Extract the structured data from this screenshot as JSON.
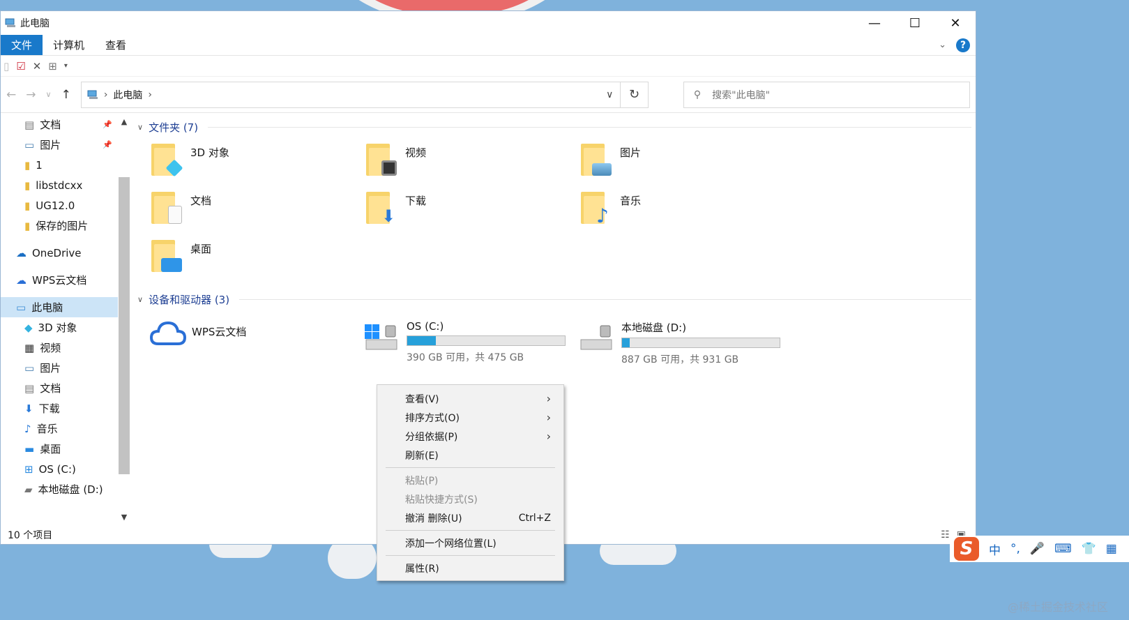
{
  "window": {
    "title": "此电脑",
    "minimize": "—",
    "maximize": "☐",
    "close": "✕"
  },
  "ribbon": {
    "tabs": [
      "文件",
      "计算机",
      "查看"
    ],
    "help": "?"
  },
  "navigation": {
    "address_location": "此电脑",
    "search_placeholder": "搜索\"此电脑\""
  },
  "sidebar": {
    "quick_access": [
      "文档",
      "图片",
      "1",
      "libstdcxx",
      "UG12.0",
      "保存的图片"
    ],
    "onedrive": "OneDrive",
    "wps": "WPS云文档",
    "this_pc": "此电脑",
    "this_pc_children": [
      "3D 对象",
      "视频",
      "图片",
      "文档",
      "下载",
      "音乐",
      "桌面",
      "OS (C:)",
      "本地磁盘 (D:)"
    ]
  },
  "folders_section": {
    "title": "文件夹 (7)",
    "items": [
      "3D 对象",
      "视频",
      "图片",
      "文档",
      "下载",
      "音乐",
      "桌面"
    ]
  },
  "drives_section": {
    "title": "设备和驱动器 (3)",
    "items": [
      {
        "name": "WPS云文档",
        "free_text": "",
        "used_fraction": null
      },
      {
        "name": "OS (C:)",
        "free_text": "390 GB 可用，共 475 GB",
        "used_fraction": 0.18
      },
      {
        "name": "本地磁盘 (D:)",
        "free_text": "887 GB 可用，共 931 GB",
        "used_fraction": 0.05
      }
    ]
  },
  "status": {
    "item_count": "10 个项目"
  },
  "context_menu": {
    "items": [
      {
        "label": "查看(V)",
        "submenu": true
      },
      {
        "label": "排序方式(O)",
        "submenu": true
      },
      {
        "label": "分组依据(P)",
        "submenu": true
      },
      {
        "label": "刷新(E)"
      },
      {
        "label": "粘贴(P)",
        "disabled": true
      },
      {
        "label": "粘贴快捷方式(S)",
        "disabled": true
      },
      {
        "label": "撤消 删除(U)",
        "shortcut": "Ctrl+Z"
      },
      {
        "label": "添加一个网络位置(L)"
      },
      {
        "label": "属性(R)"
      }
    ]
  },
  "ime": {
    "logo": "S",
    "mode": "中",
    "punct": "°,"
  },
  "watermark": "@稀土掘金技术社区",
  "colors": {
    "accent": "#1979ca",
    "selected": "#cce4f7",
    "bar_fill": "#26a0da",
    "section_title": "#1e3f93",
    "desktop": "#7fb2dc"
  }
}
